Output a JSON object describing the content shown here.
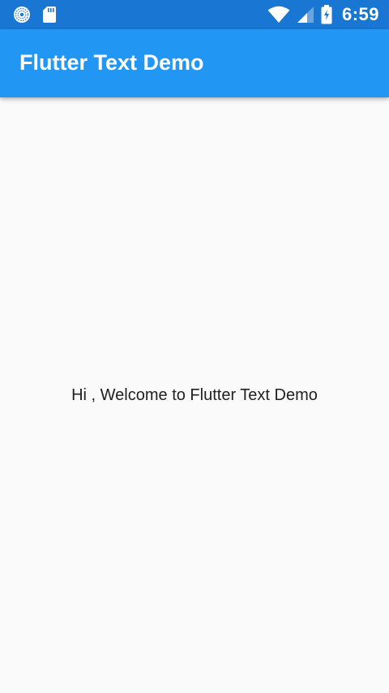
{
  "status_bar": {
    "time": "6:59",
    "color": "#1976d2",
    "icons_left": [
      "notification-icon",
      "sd-card-icon"
    ],
    "icons_right": [
      "wifi-icon",
      "cellular-signal-icon",
      "battery-charging-icon"
    ]
  },
  "app_bar": {
    "title": "Flutter Text Demo",
    "color": "#2196f3"
  },
  "main": {
    "text": "Hi , Welcome to Flutter Text Demo",
    "background": "#fafafa"
  }
}
